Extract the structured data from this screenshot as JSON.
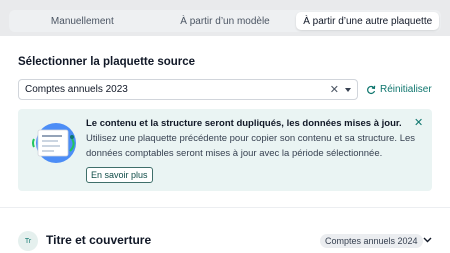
{
  "tabs": [
    {
      "label": "Manuellement",
      "active": false
    },
    {
      "label": "À partir d’un modèle",
      "active": false
    },
    {
      "label": "À partir d’une autre plaquette",
      "active": true
    }
  ],
  "source": {
    "title": "Sélectionner la plaquette source",
    "selected_value": "Comptes annuels 2023",
    "reset_label": "Réinitialiser"
  },
  "banner": {
    "title": "Le contenu et la structure seront dupliqués, les données mises à jour.",
    "body": "Utilisez une plaquette précédente pour copier son contenu et sa structure. Les données comptables seront mises à jour avec la période sélectionnée.",
    "button_label": "En savoir plus"
  },
  "section": {
    "avatar_text": "Tr",
    "title": "Titre et couverture",
    "badge": "Comptes annuels 2024"
  },
  "colors": {
    "accent": "#0f766e",
    "banner_bg": "#eaf4f3"
  }
}
